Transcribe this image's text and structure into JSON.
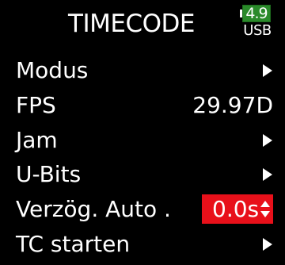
{
  "header": {
    "title": "TIMECODE",
    "battery_value": "4.9",
    "power_source": "USB"
  },
  "colors": {
    "background": "#000000",
    "text": "#ffffff",
    "battery_fill": "#2a8a2a",
    "selection": "#e8101a"
  },
  "menu": {
    "items": [
      {
        "label": "Modus",
        "icon": "chevron-right-icon"
      },
      {
        "label": "FPS",
        "value": "29.97D"
      },
      {
        "label": "Jam",
        "icon": "chevron-right-icon"
      },
      {
        "label": "U-Bits",
        "icon": "chevron-right-icon"
      },
      {
        "label": "Verzög. Auto .",
        "value": "0.0s",
        "selected": true,
        "icon": "up-down-arrows-icon"
      },
      {
        "label": "TC starten",
        "icon": "chevron-right-icon"
      }
    ]
  }
}
